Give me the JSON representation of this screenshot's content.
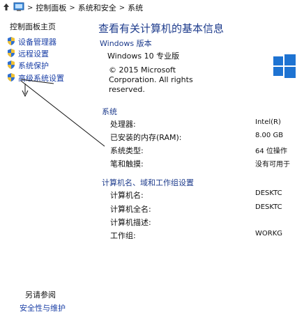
{
  "breadcrumb": {
    "items": [
      "控制面板",
      "系统和安全",
      "系统"
    ]
  },
  "left_nav": {
    "title": "控制面板主页",
    "links": [
      "设备管理器",
      "远程设置",
      "系统保护",
      "高级系统设置"
    ],
    "see_also_title": "另请参阅",
    "see_also_links": [
      "安全性与维护"
    ]
  },
  "main": {
    "title": "查看有关计算机的基本信息",
    "windows_edition": {
      "heading": "Windows 版本",
      "edition": "Windows 10 专业版",
      "copyright": "© 2015 Microsoft Corporation. All rights reserved."
    },
    "system": {
      "heading": "系统",
      "rows": [
        {
          "label": "处理器:",
          "value": "Intel(R)"
        },
        {
          "label": "已安装的内存(RAM):",
          "value": "8.00 GB"
        },
        {
          "label": "系统类型:",
          "value": "64 位操作"
        },
        {
          "label": "笔和触摸:",
          "value": "没有可用于"
        }
      ]
    },
    "computer": {
      "heading": "计算机名、域和工作组设置",
      "rows": [
        {
          "label": "计算机名:",
          "value": "DESKTC"
        },
        {
          "label": "计算机全名:",
          "value": "DESKTC"
        },
        {
          "label": "计算机描述:",
          "value": ""
        },
        {
          "label": "工作组:",
          "value": "WORKG"
        }
      ]
    }
  },
  "colors": {
    "link": "#1a3fa6",
    "heading": "#1d3b8c",
    "windows_blue": "#1e73d2"
  },
  "icons": [
    "control-panel-icon",
    "shield-icon",
    "windows-logo-icon"
  ]
}
